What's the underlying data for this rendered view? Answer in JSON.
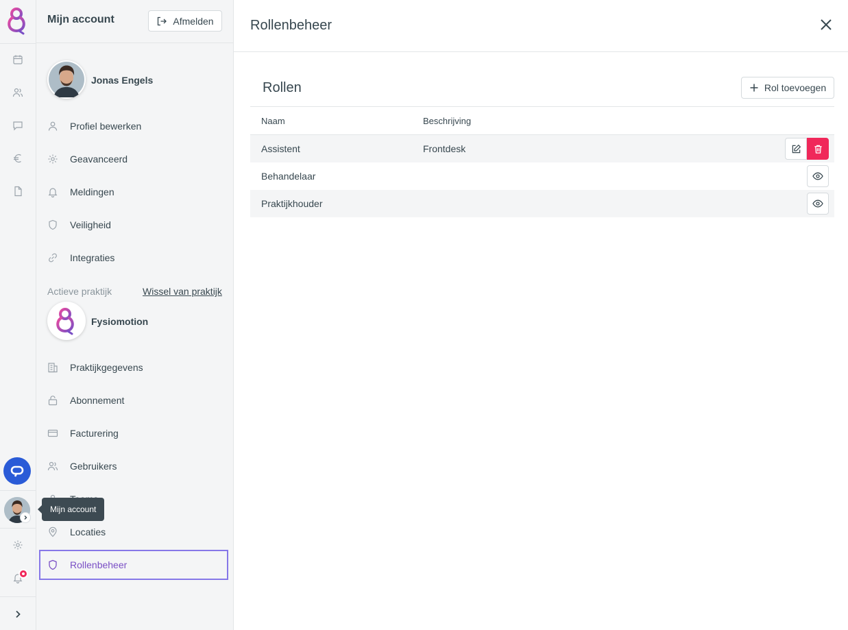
{
  "app": {
    "brand_color": "#7a4fc5",
    "accent_blue": "#2a5bd7",
    "danger_color": "#f0285a"
  },
  "rail": {
    "items": [
      {
        "name": "calendar-icon"
      },
      {
        "name": "users-icon"
      },
      {
        "name": "chat-icon"
      },
      {
        "name": "euro-icon"
      },
      {
        "name": "document-icon"
      }
    ],
    "tooltip": "Mijn account",
    "notification_badge": true
  },
  "account_panel": {
    "title": "Mijn account",
    "logout_label": "Afmelden",
    "user_name": "Jonas Engels",
    "personal_menu": [
      {
        "label": "Profiel bewerken",
        "icon": "user-icon"
      },
      {
        "label": "Geavanceerd",
        "icon": "gear-icon"
      },
      {
        "label": "Meldingen",
        "icon": "bell-icon"
      },
      {
        "label": "Veiligheid",
        "icon": "shield-icon"
      },
      {
        "label": "Integraties",
        "icon": "link-icon"
      }
    ],
    "active_practice_label": "Actieve praktijk",
    "switch_practice_label": "Wissel van praktijk",
    "practice_name": "Fysiomotion",
    "practice_menu": [
      {
        "label": "Praktijkgegevens",
        "icon": "building-icon"
      },
      {
        "label": "Abonnement",
        "icon": "lock-icon"
      },
      {
        "label": "Facturering",
        "icon": "credit-card-icon"
      },
      {
        "label": "Gebruikers",
        "icon": "users-icon"
      },
      {
        "label": "Teams",
        "icon": "team-icon"
      },
      {
        "label": "Locaties",
        "icon": "map-pin-icon"
      },
      {
        "label": "Rollenbeheer",
        "icon": "shield-icon",
        "active": true
      }
    ]
  },
  "main": {
    "title": "Rollenbeheer",
    "section_title": "Rollen",
    "add_button_label": "Rol toevoegen",
    "table": {
      "columns": [
        "Naam",
        "Beschrijving"
      ],
      "rows": [
        {
          "name": "Assistent",
          "description": "Frontdesk",
          "actions": [
            "edit",
            "delete"
          ]
        },
        {
          "name": "Behandelaar",
          "description": "",
          "actions": [
            "view"
          ]
        },
        {
          "name": "Praktijkhouder",
          "description": "",
          "actions": [
            "view"
          ]
        }
      ]
    }
  }
}
